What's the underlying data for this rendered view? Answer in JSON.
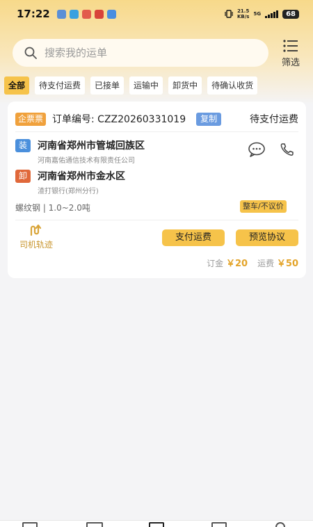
{
  "status_bar": {
    "time": "17:22",
    "net_speed_value": "21.5",
    "net_speed_unit": "KB/s",
    "network": "5G",
    "battery": "68"
  },
  "search": {
    "placeholder": "搜索我的运单",
    "filter_label": "筛选"
  },
  "tabs": [
    {
      "label": "全部",
      "active": true
    },
    {
      "label": "待支付运费",
      "active": false
    },
    {
      "label": "已接单",
      "active": false
    },
    {
      "label": "运输中",
      "active": false
    },
    {
      "label": "卸货中",
      "active": false
    },
    {
      "label": "待确认收货",
      "active": false
    }
  ],
  "order": {
    "invoice_tag": "企票票",
    "order_no": "订单编号: CZZ20260331019",
    "copy_label": "复制",
    "status": "待支付运费",
    "load": {
      "tag": "装",
      "address": "河南省郑州市管城回族区",
      "company": "河南嘉佑通信技术有限责任公司"
    },
    "unload": {
      "tag": "卸",
      "address": "河南省郑州市金水区",
      "company": "渣打银行(郑州分行)"
    },
    "cargo": "螺纹钢 | 1.0~2.0吨",
    "price_tag": "整车/不议价",
    "track_label": "司机轨迹",
    "pay_button": "支付运费",
    "preview_button": "预览协议",
    "deposit_label": "订金",
    "deposit_value": "￥20",
    "freight_label": "运费",
    "freight_value": "￥50"
  },
  "colors": {
    "accent": "#f6c34a",
    "load_tag": "#4a8fdc",
    "unload_tag": "#e0683a",
    "invoice_tag": "#f0a13c",
    "copy_button": "#6a9be0"
  }
}
